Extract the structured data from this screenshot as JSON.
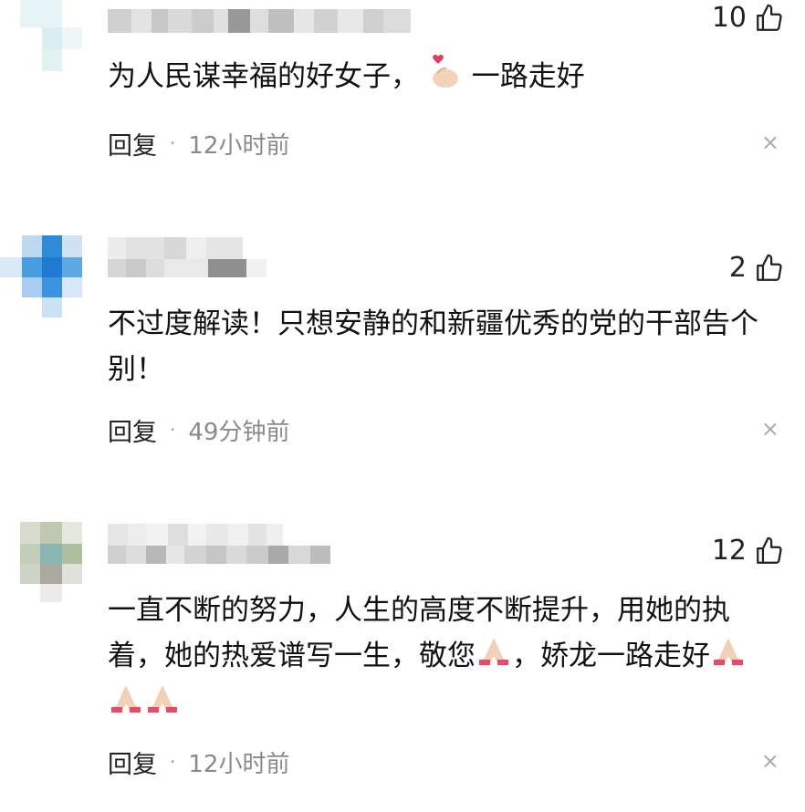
{
  "comments": [
    {
      "likes": "10",
      "text": "为人民谋幸福的好女子，",
      "emoji_1": "heart-hand-emoji",
      "text_after": "一路走好",
      "reply_label": "回复",
      "separator": "·",
      "time": "12小时前",
      "close": "×"
    },
    {
      "likes": "2",
      "text": "不过度解读！只想安静的和新疆优秀的党的干部告个别！",
      "reply_label": "回复",
      "separator": "·",
      "time": "49分钟前",
      "close": "×"
    },
    {
      "likes": "12",
      "text_1": "一直不断的努力，人生的高度不断提升，用她的执着，她的热爱谱写一生，敬您",
      "text_2": "，娇龙一路走好",
      "emoji_name": "folded-hands-emoji",
      "reply_label": "回复",
      "separator": "·",
      "time": "12小时前",
      "close": "×"
    }
  ],
  "colors": {
    "background": "#ffffff",
    "muted": "#8a8a8a",
    "text": "#111111"
  }
}
